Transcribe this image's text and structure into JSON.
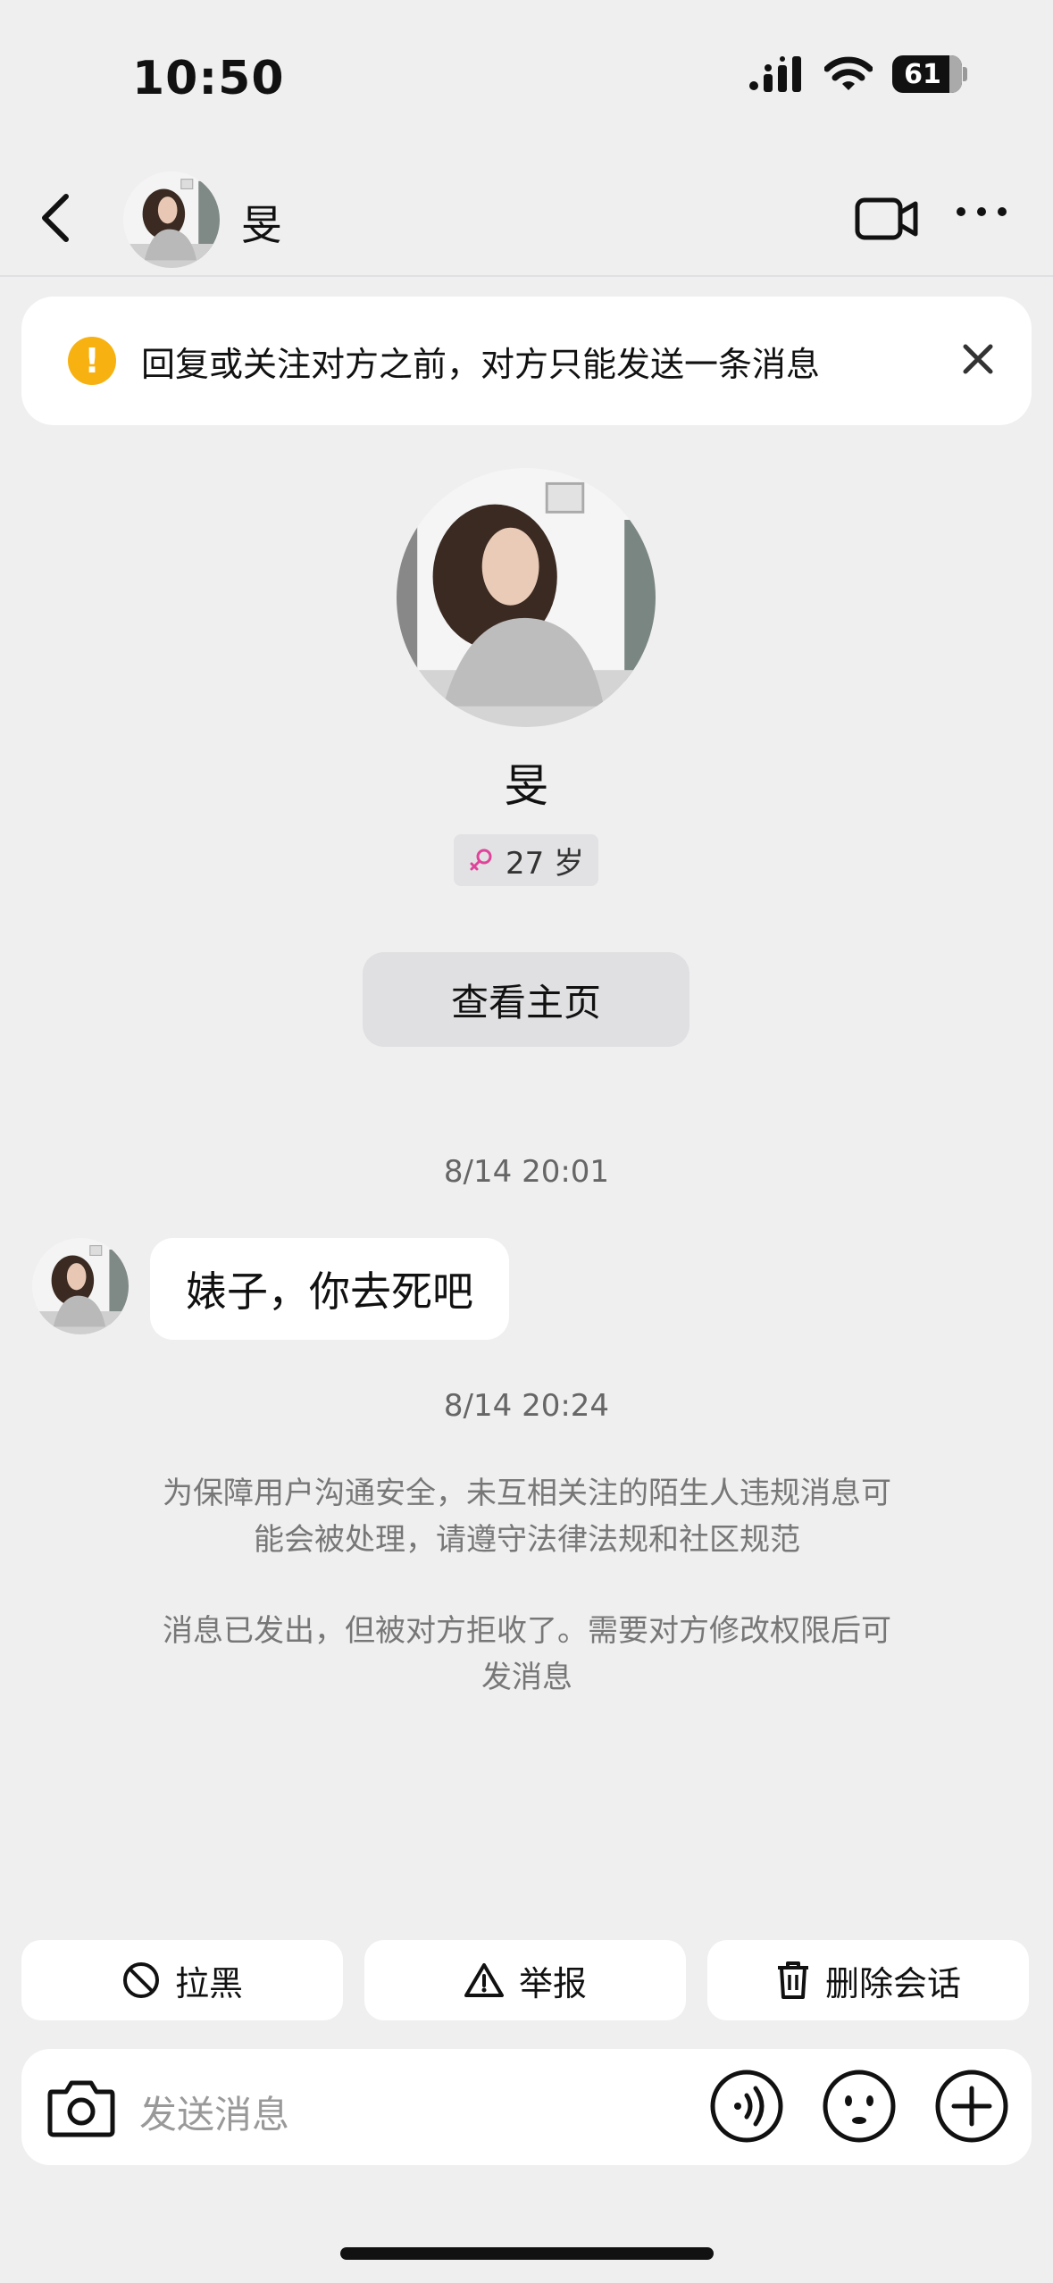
{
  "status_bar": {
    "time": "10:50",
    "battery": "61"
  },
  "header": {
    "contact_name": "旻"
  },
  "banner": {
    "text": "回复或关注对方之前，对方只能发送一条消息"
  },
  "profile": {
    "name": "旻",
    "age": "27 岁",
    "homepage_button": "查看主页"
  },
  "messages": [
    {
      "timestamp": "8/14 20:01",
      "text": "婊子，你去死吧"
    }
  ],
  "system": {
    "timestamp": "8/14 20:24",
    "notice_line1": "为保障用户沟通安全，未互相关注的陌生人违规消息可",
    "notice_line2": "能会被处理，请遵守法律法规和社区规范",
    "rejected_line1": "消息已发出，但被对方拒收了。需要对方修改权限后可",
    "rejected_line2": "发消息"
  },
  "actions": {
    "block": "拉黑",
    "report": "举报",
    "delete": "删除会话"
  },
  "input": {
    "placeholder": "发送消息"
  },
  "colors": {
    "background": "#efeff0",
    "warning": "#f7b212",
    "female": "#e0439a"
  }
}
